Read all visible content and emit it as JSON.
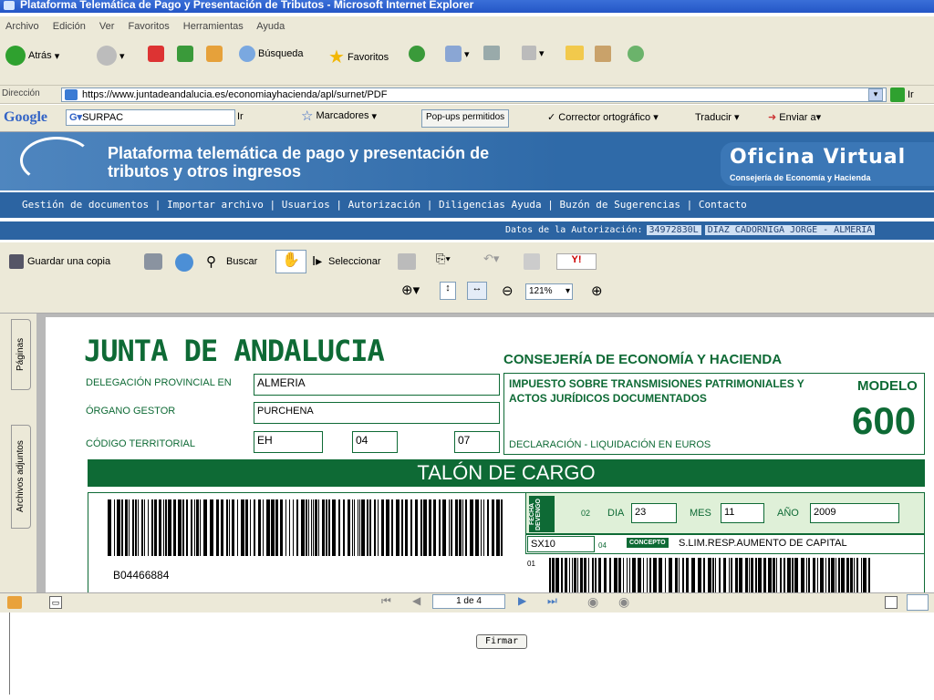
{
  "window": {
    "title": "Plataforma Telemática de Pago y Presentación de Tributos - Microsoft Internet Explorer"
  },
  "menu": [
    "Archivo",
    "Edición",
    "Ver",
    "Favoritos",
    "Herramientas",
    "Ayuda"
  ],
  "toolbar": {
    "back": "Atrás",
    "search": "Búsqueda",
    "favorites": "Favoritos"
  },
  "address": {
    "label": "Dirección",
    "url": "https://www.juntadeandalucia.es/economiayhacienda/apl/surnet/PDF",
    "go": "Ir"
  },
  "google": {
    "logo": "Google",
    "query": "SURPAC",
    "go": "Ir",
    "bookmarks": "Marcadores",
    "popups": "Pop-ups permitidos",
    "spell": "Corrector ortográfico",
    "translate": "Traducir",
    "send": "Enviar a"
  },
  "banner": {
    "title": "Plataforma telemática de pago y presentación de tributos y otros ingresos",
    "office": "Oficina Virtual",
    "office_sub": "Consejería de Economía y Hacienda"
  },
  "nav": [
    "Gestión de documentos",
    "Importar archivo",
    "Usuarios",
    "Autorización",
    "Diligencias",
    "Ayuda",
    "Buzón de Sugerencias",
    "Contacto"
  ],
  "auth": {
    "label": "Datos de la Autorización:",
    "nif": "34972830L",
    "name": "DIAZ CADORNIGA JORGE - ALMERIA"
  },
  "pdf": {
    "save": "Guardar una copia",
    "search": "Buscar",
    "select": "Seleccionar",
    "zoom": "121%",
    "page": "1 de 4"
  },
  "tabs": [
    "Páginas",
    "Archivos adjuntos"
  ],
  "form": {
    "junta": "JUNTA DE ANDALUCIA",
    "consejeria": "CONSEJERÍA DE ECONOMÍA Y HACIENDA",
    "deleg_label": "DELEGACIÓN PROVINCIAL EN",
    "deleg_val": "ALMERIA",
    "organo_label": "ÓRGANO GESTOR",
    "organo_val": "PURCHENA",
    "codigo_label": "CÓDIGO TERRITORIAL",
    "cod1": "EH",
    "cod2": "04",
    "cod3": "07",
    "impuesto": "IMPUESTO SOBRE TRANSMISIONES PATRIMONIALES Y ACTOS JURÍDICOS DOCUMENTADOS",
    "modelo": "MODELO",
    "numero": "600",
    "declaracion": "DECLARACIÓN - LIQUIDACIÓN EN EUROS",
    "talon": "TALÓN DE CARGO",
    "barcode_num": "B04466884",
    "fecha_label": "FECHA DEVENGO",
    "f02": "02",
    "dia_label": "DIA",
    "dia": "23",
    "mes_label": "MES",
    "mes": "11",
    "anio_label": "AÑO",
    "anio": "2009",
    "sx": "SX10",
    "f04": "04",
    "concepto_label": "CONCEPTO",
    "concepto": "S.LIM.RESP.AUMENTO DE CAPITAL",
    "f01": "01"
  },
  "firmar": "Firmar"
}
